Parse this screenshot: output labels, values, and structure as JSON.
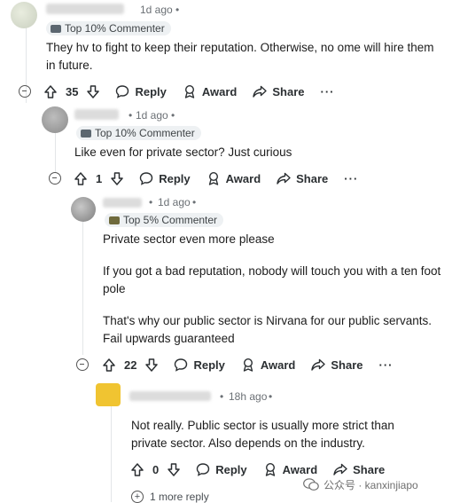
{
  "comments": [
    {
      "timestamp": "1d ago",
      "flair": "Top 10% Commenter",
      "body": [
        "They hv to fight to keep their reputation. Otherwise, no ome will hire them in future."
      ],
      "votes": "35"
    },
    {
      "timestamp": "1d ago",
      "flair": "Top 10% Commenter",
      "body": [
        "Like even for private sector? Just curious"
      ],
      "votes": "1"
    },
    {
      "timestamp": "1d ago",
      "flair": "Top 5% Commenter",
      "body": [
        "Private sector even more please",
        "If you got a bad reputation, nobody will touch you with a ten foot pole",
        "That's why our public sector is Nirvana for our public servants. Fail upwards guaranteed"
      ],
      "votes": "22"
    },
    {
      "timestamp": "18h ago",
      "body": [
        "Not really. Public sector is usually more strict than private sector. Also depends on the industry."
      ],
      "votes": "0"
    }
  ],
  "action_labels": {
    "reply": "Reply",
    "award": "Award",
    "share": "Share",
    "more": "···"
  },
  "more_replies": "1 more reply",
  "watermark": "公众号 · kanxinjiapo"
}
